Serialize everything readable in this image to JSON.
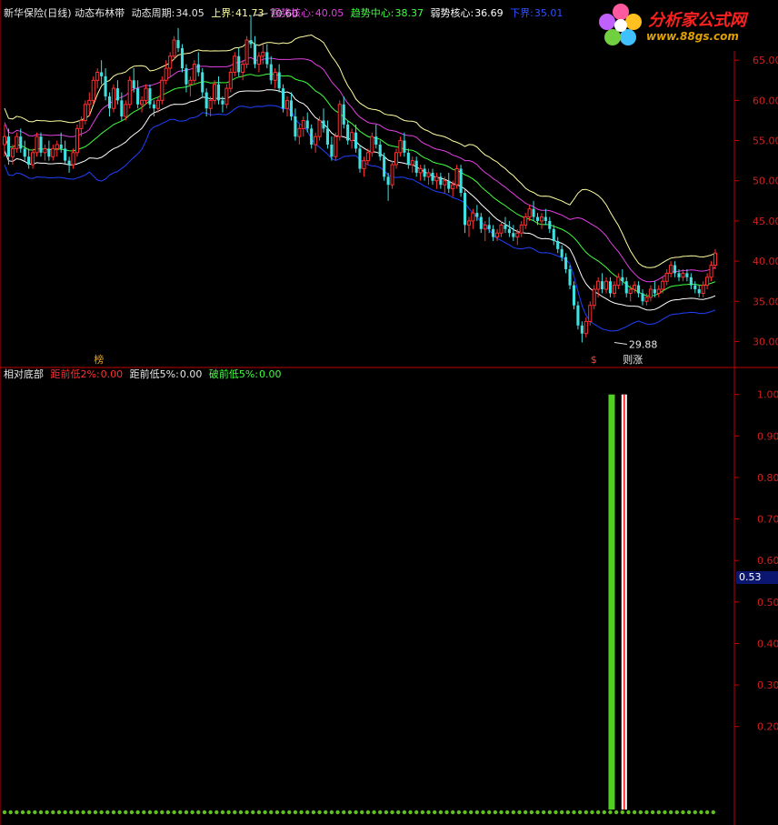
{
  "header": {
    "title": "新华保险(日线) 动态布林带",
    "period_label": "动态周期:",
    "period_value": "34.05",
    "upper_label": "上界:",
    "upper_value": "41.73",
    "strong_label": "强势核心:",
    "strong_value": "40.05",
    "trend_label": "趋势中心:",
    "trend_value": "38.37",
    "weak_label": "弱势核心:",
    "weak_value": "36.69",
    "lower_label": "下界:",
    "lower_value": "35.01"
  },
  "indicator_header": {
    "title": "相对底部",
    "d2_label": "距前低2%:",
    "d2_value": "0.00",
    "d5_label": "距前低5%:",
    "d5_value": "0.00",
    "b5_label": "破前低5%:",
    "b5_value": "0.00"
  },
  "logo": {
    "name": "分析家公式网",
    "url": "www.88gs.com"
  },
  "colors": {
    "up": "#ff3030",
    "down": "#40e0e0",
    "upper_band": "#ffffa0",
    "strong": "#e040e0",
    "trend": "#40ff40",
    "weak": "#ffffff",
    "lower_band": "#2040ff",
    "axis": "#c00000"
  },
  "chart_data": [
    {
      "type": "candlestick",
      "yticks": [
        30,
        35,
        40,
        45,
        50,
        55,
        60,
        65
      ],
      "ylim": [
        27,
        70
      ],
      "annotations": [
        {
          "text": "70.60",
          "index": 62
        },
        {
          "text": "29.88",
          "index": 151
        },
        {
          "text": "榜",
          "index": 23
        },
        {
          "text": "$",
          "index": 146
        },
        {
          "text": "则涨",
          "index": 154
        }
      ],
      "candles": [
        [
          54.5,
          57,
          53,
          55.5
        ],
        [
          55.5,
          56.5,
          52,
          53
        ],
        [
          53,
          54.5,
          52,
          54
        ],
        [
          54,
          56,
          53.5,
          55.5
        ],
        [
          55.5,
          56.5,
          53.5,
          54
        ],
        [
          54,
          55,
          52.5,
          53
        ],
        [
          53,
          54,
          51.5,
          52
        ],
        [
          52,
          54,
          51.5,
          53.5
        ],
        [
          53.5,
          56,
          53,
          55.5
        ],
        [
          55.5,
          56,
          53,
          53.5
        ],
        [
          53.5,
          54.5,
          52.5,
          54
        ],
        [
          54,
          55,
          52.5,
          53
        ],
        [
          53,
          54.5,
          52.5,
          54
        ],
        [
          54,
          55,
          53,
          54.5
        ],
        [
          54.5,
          56,
          53.5,
          54
        ],
        [
          54,
          55,
          52,
          52.5
        ],
        [
          52.5,
          53,
          51,
          52
        ],
        [
          52,
          54,
          51.5,
          53.5
        ],
        [
          53.5,
          57,
          53,
          56.5
        ],
        [
          56.5,
          58,
          55.5,
          57.5
        ],
        [
          57.5,
          60,
          57,
          59.5
        ],
        [
          59.5,
          61,
          58,
          60
        ],
        [
          60,
          63,
          59.5,
          62.5
        ],
        [
          62.5,
          64,
          61.5,
          63.5
        ],
        [
          63.5,
          65,
          62,
          63
        ],
        [
          63,
          64,
          60,
          60.5
        ],
        [
          60.5,
          61,
          58,
          59
        ],
        [
          59,
          62,
          58.5,
          61.5
        ],
        [
          61.5,
          62.5,
          59.5,
          60
        ],
        [
          60,
          61,
          57.5,
          58
        ],
        [
          58,
          60,
          57.5,
          59.5
        ],
        [
          59.5,
          63,
          59,
          62.5
        ],
        [
          62.5,
          64,
          61,
          61.5
        ],
        [
          61.5,
          62.5,
          59,
          59.5
        ],
        [
          59.5,
          60.5,
          58.5,
          60
        ],
        [
          60,
          62,
          59.5,
          61.5
        ],
        [
          61.5,
          62,
          59,
          59.5
        ],
        [
          59.5,
          60,
          58,
          59
        ],
        [
          59,
          60.5,
          58.5,
          60
        ],
        [
          60,
          63,
          59.5,
          62.5
        ],
        [
          62.5,
          65,
          62,
          64
        ],
        [
          64,
          66,
          63,
          65.5
        ],
        [
          65.5,
          68,
          65,
          67.5
        ],
        [
          67.5,
          69,
          66,
          66.5
        ],
        [
          66.5,
          67,
          63.5,
          64
        ],
        [
          64,
          64.5,
          61,
          62
        ],
        [
          62,
          63,
          60.5,
          62.5
        ],
        [
          62.5,
          65,
          62,
          64.5
        ],
        [
          64.5,
          66,
          63,
          63.5
        ],
        [
          63.5,
          64,
          60.5,
          61
        ],
        [
          61,
          61.5,
          58,
          59
        ],
        [
          59,
          60.5,
          58,
          60
        ],
        [
          60,
          62.5,
          59.5,
          62
        ],
        [
          62,
          63,
          59.5,
          60
        ],
        [
          60,
          60.5,
          58.5,
          59.5
        ],
        [
          59.5,
          62,
          59,
          61.5
        ],
        [
          61.5,
          64,
          61,
          63.5
        ],
        [
          63.5,
          66,
          63,
          65.5
        ],
        [
          65.5,
          66.5,
          63,
          63.5
        ],
        [
          63.5,
          65,
          62.5,
          64.5
        ],
        [
          64.5,
          68,
          64,
          67.5
        ],
        [
          67.5,
          70.6,
          66.5,
          67
        ],
        [
          67,
          68,
          64,
          64.5
        ],
        [
          64.5,
          66,
          63.5,
          65.5
        ],
        [
          65.5,
          67,
          64.5,
          66
        ],
        [
          66,
          67,
          64,
          64.5
        ],
        [
          64.5,
          65.5,
          62,
          62.5
        ],
        [
          62.5,
          64,
          61.5,
          63.5
        ],
        [
          63.5,
          64.5,
          61,
          61.5
        ],
        [
          61.5,
          62,
          58.5,
          59
        ],
        [
          59,
          60.5,
          58,
          60
        ],
        [
          60,
          61,
          57.5,
          58
        ],
        [
          58,
          59,
          55,
          55.5
        ],
        [
          55.5,
          57,
          54.5,
          56.5
        ],
        [
          56.5,
          58,
          55.5,
          57.5
        ],
        [
          57.5,
          58.5,
          56,
          56.5
        ],
        [
          56.5,
          57,
          54,
          54.5
        ],
        [
          54.5,
          56,
          53.5,
          55.5
        ],
        [
          55.5,
          58,
          55,
          57.5
        ],
        [
          57.5,
          59,
          56,
          56.5
        ],
        [
          56.5,
          57.5,
          54,
          54.5
        ],
        [
          54.5,
          55.5,
          52.5,
          53
        ],
        [
          53,
          56,
          52.5,
          55.5
        ],
        [
          55.5,
          60,
          55,
          59.5
        ],
        [
          59.5,
          60.5,
          56.5,
          57
        ],
        [
          57,
          57.5,
          54.5,
          55
        ],
        [
          55,
          56.5,
          54,
          56
        ],
        [
          56,
          57,
          53.5,
          54
        ],
        [
          54,
          54.5,
          51,
          51.5
        ],
        [
          51.5,
          53,
          50.5,
          52.5
        ],
        [
          52.5,
          54,
          52,
          53.5
        ],
        [
          53.5,
          56,
          53,
          55.5
        ],
        [
          55.5,
          57,
          54,
          54.5
        ],
        [
          54.5,
          55,
          52.5,
          53
        ],
        [
          53,
          53.5,
          50,
          50.5
        ],
        [
          50.5,
          51,
          47.5,
          49.5
        ],
        [
          49.5,
          52.5,
          49,
          52
        ],
        [
          52,
          54,
          51.5,
          53.5
        ],
        [
          53.5,
          55.5,
          53,
          55
        ],
        [
          55,
          56,
          53,
          53.5
        ],
        [
          53.5,
          54,
          51.5,
          52
        ],
        [
          52,
          53,
          51,
          52.5
        ],
        [
          52.5,
          53,
          50.5,
          51
        ],
        [
          51,
          52,
          50,
          51.5
        ],
        [
          51.5,
          52,
          50,
          50.5
        ],
        [
          50.5,
          51.5,
          49.5,
          51
        ],
        [
          51,
          51.5,
          49.5,
          50
        ],
        [
          50,
          51,
          49,
          50.5
        ],
        [
          50.5,
          51,
          49,
          49.5
        ],
        [
          49.5,
          50.5,
          48.5,
          50
        ],
        [
          50,
          51,
          48.5,
          49
        ],
        [
          49,
          50,
          48,
          49.5
        ],
        [
          49.5,
          52,
          49,
          51.5
        ],
        [
          51.5,
          52,
          48,
          48.5
        ],
        [
          48.5,
          49,
          43.5,
          44.5
        ],
        [
          44.5,
          45.5,
          43,
          45
        ],
        [
          45,
          46.5,
          44,
          46
        ],
        [
          46,
          47,
          45,
          45.5
        ],
        [
          45.5,
          46,
          43.5,
          44
        ],
        [
          44,
          45,
          42.5,
          44.5
        ],
        [
          44.5,
          45.5,
          43.5,
          44
        ],
        [
          44,
          44.5,
          42.5,
          43
        ],
        [
          43,
          44,
          42.5,
          43.5
        ],
        [
          43.5,
          45,
          43,
          44.5
        ],
        [
          44.5,
          45.5,
          43.5,
          44
        ],
        [
          44,
          45,
          43,
          43.5
        ],
        [
          43.5,
          44.5,
          42.5,
          43
        ],
        [
          43,
          44,
          42,
          43.5
        ],
        [
          43.5,
          45,
          43,
          44.5
        ],
        [
          44.5,
          46,
          44,
          45.5
        ],
        [
          45.5,
          47,
          45,
          46.5
        ],
        [
          46.5,
          47.5,
          45,
          45.5
        ],
        [
          45.5,
          46,
          44.5,
          45
        ],
        [
          45,
          46,
          44,
          45.5
        ],
        [
          45.5,
          46.5,
          44.5,
          45
        ],
        [
          45,
          45.5,
          43.5,
          44
        ],
        [
          44,
          44.5,
          42,
          42.5
        ],
        [
          42.5,
          43,
          41,
          41.5
        ],
        [
          41.5,
          42,
          40,
          40.5
        ],
        [
          40.5,
          41,
          38.5,
          39
        ],
        [
          39,
          39.5,
          36.5,
          37
        ],
        [
          37,
          37.5,
          34,
          34.5
        ],
        [
          34.5,
          35,
          31.5,
          32
        ],
        [
          32,
          32.5,
          29.88,
          31
        ],
        [
          31,
          33,
          30.5,
          32.5
        ],
        [
          32.5,
          35,
          32,
          34.5
        ],
        [
          34.5,
          37,
          34,
          36.5
        ],
        [
          36.5,
          38,
          35.5,
          37.5
        ],
        [
          37.5,
          38.5,
          36,
          36.5
        ],
        [
          36.5,
          38,
          36,
          37.5
        ],
        [
          37.5,
          38,
          35.5,
          36
        ],
        [
          36,
          37.5,
          35.5,
          37
        ],
        [
          37,
          38.5,
          36.5,
          38
        ],
        [
          38,
          39,
          37,
          37.5
        ],
        [
          37.5,
          38,
          35.5,
          36
        ],
        [
          36,
          37,
          35,
          36.5
        ],
        [
          36.5,
          37.5,
          36,
          37
        ],
        [
          37,
          37.5,
          35.5,
          36
        ],
        [
          36,
          36.5,
          34.5,
          35
        ],
        [
          35,
          36,
          34.5,
          35.5
        ],
        [
          35.5,
          37,
          35,
          36.5
        ],
        [
          36.5,
          37.5,
          35.5,
          36
        ],
        [
          36,
          37,
          35.5,
          36.5
        ],
        [
          36.5,
          38,
          36,
          37.5
        ],
        [
          37.5,
          39,
          37,
          38.5
        ],
        [
          38.5,
          40,
          38,
          39.5
        ],
        [
          39.5,
          40,
          38,
          38.5
        ],
        [
          38.5,
          39,
          37.5,
          38
        ],
        [
          38,
          39,
          37.5,
          38.5
        ],
        [
          38.5,
          39,
          37.5,
          38
        ],
        [
          38,
          38.5,
          36.5,
          37
        ],
        [
          37,
          37.5,
          36,
          36.5
        ],
        [
          36.5,
          37,
          35.5,
          36
        ],
        [
          36,
          37.5,
          35.5,
          37
        ],
        [
          37,
          38.5,
          36.5,
          38
        ],
        [
          38,
          40,
          37.5,
          39.5
        ],
        [
          39.5,
          41.5,
          39,
          41
        ]
      ]
    },
    {
      "type": "bar",
      "yticks": [
        0.2,
        0.3,
        0.4,
        0.5,
        0.6,
        0.7,
        0.8,
        0.9,
        1.0
      ],
      "ylim": [
        0,
        1.03
      ],
      "current_value": "0.53",
      "bars": [
        {
          "index": 150,
          "value": 1.0,
          "color": "green"
        },
        {
          "index": 153,
          "value": 1.0,
          "color": "red"
        }
      ],
      "baseline_dots": {
        "value": 0,
        "color": "#60c020"
      }
    }
  ]
}
